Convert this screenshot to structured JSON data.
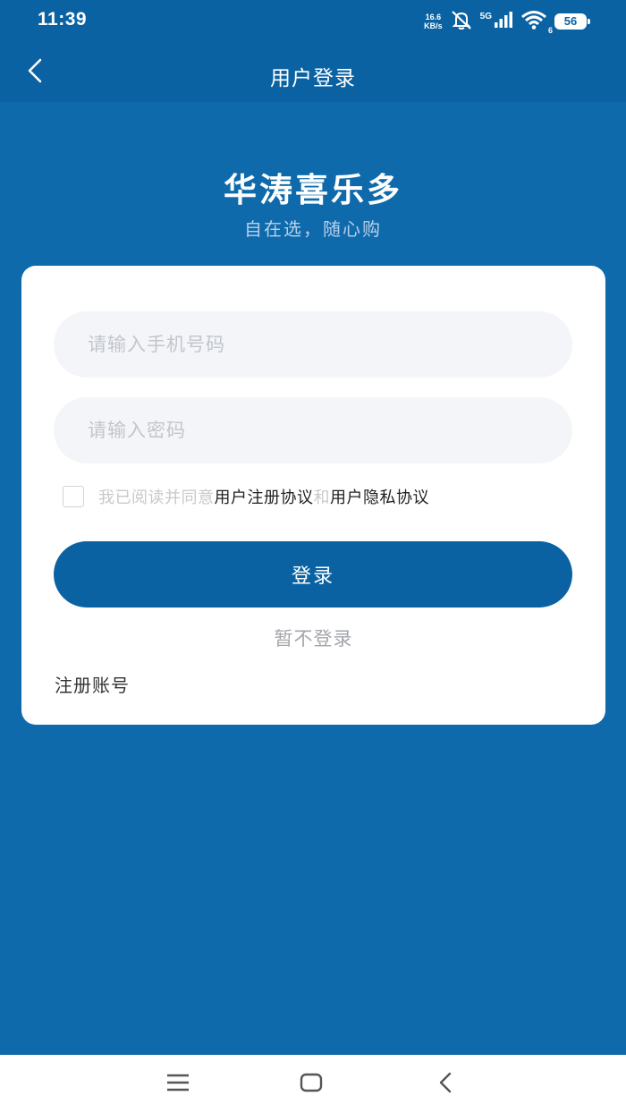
{
  "status_bar": {
    "time": "11:39",
    "net_speed_value": "16.6",
    "net_speed_unit": "KB/s",
    "signal_label": "5G",
    "wifi_label": "6",
    "battery": "56",
    "icons": [
      "mute-icon",
      "cellular-signal-icon",
      "wifi-icon",
      "battery-icon"
    ]
  },
  "nav": {
    "back_icon": "chevron-left-icon",
    "title": "用户登录"
  },
  "brand": {
    "title": "华涛喜乐多",
    "subtitle": "自在选，随心购"
  },
  "form": {
    "phone_placeholder": "请输入手机号码",
    "phone_value": "",
    "password_placeholder": "请输入密码",
    "password_value": "",
    "agree_checked": false,
    "agree_prefix": "我已阅读并同意",
    "agree_link1": "用户注册协议",
    "agree_and": "和",
    "agree_link2": "用户隐私协议",
    "login_label": "登录",
    "skip_label": "暂不登录",
    "register_label": "注册账号"
  },
  "system_nav": {
    "icons": [
      "menu-icon",
      "home-icon",
      "back-icon"
    ]
  },
  "colors": {
    "primary": "#0a62a3",
    "background": "#0f6aab",
    "card": "#ffffff",
    "input_bg": "#f3f5f8"
  }
}
